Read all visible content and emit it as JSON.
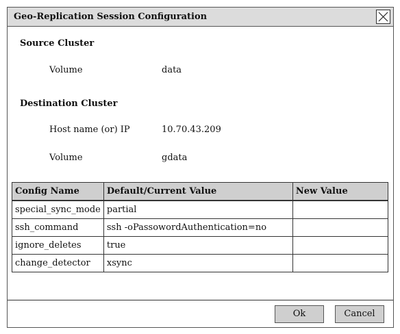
{
  "dialog": {
    "title": "Geo-Replication Session Configuration"
  },
  "source": {
    "heading": "Source Cluster",
    "volume_label": "Volume",
    "volume_value": "data"
  },
  "destination": {
    "heading": "Destination Cluster",
    "host_label": "Host name (or) IP",
    "host_value": "10.70.43.209",
    "volume_label": "Volume",
    "volume_value": "gdata"
  },
  "table": {
    "headers": [
      "Config Name",
      "Default/Current Value",
      "New Value"
    ],
    "rows": [
      {
        "name": "special_sync_mode",
        "value": "partial",
        "new": ""
      },
      {
        "name": "ssh_command",
        "value": "ssh -oPassowordAuthentication=no",
        "new": ""
      },
      {
        "name": "ignore_deletes",
        "value": "true",
        "new": ""
      },
      {
        "name": "change_detector",
        "value": "xsync",
        "new": ""
      }
    ]
  },
  "buttons": {
    "ok": "Ok",
    "cancel": "Cancel"
  }
}
